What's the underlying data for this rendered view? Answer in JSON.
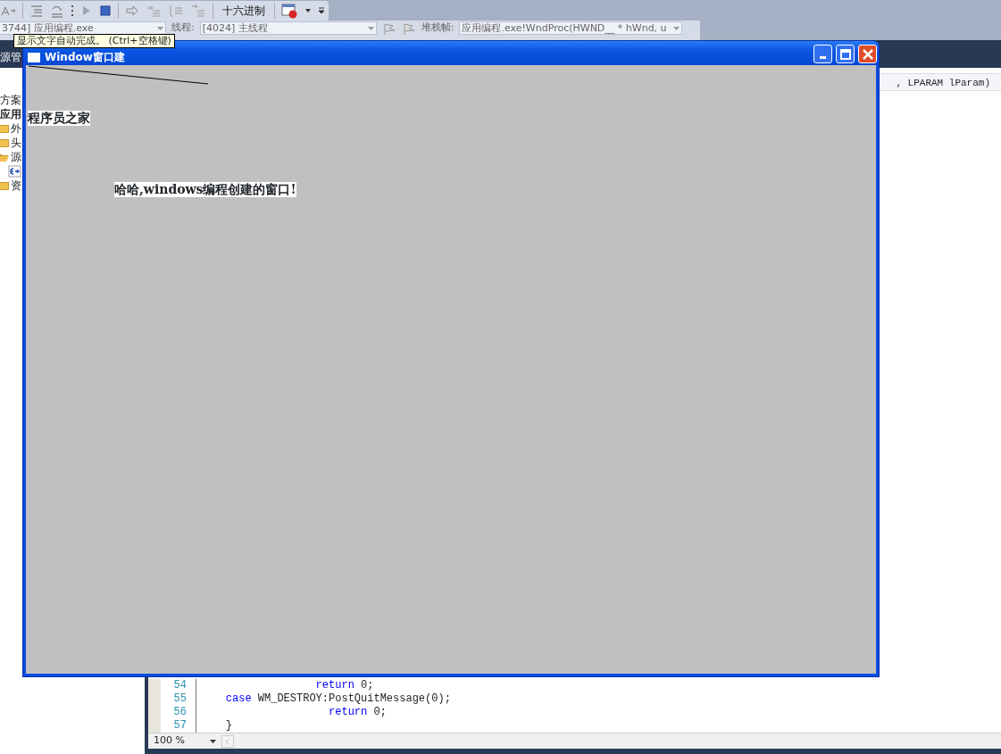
{
  "toolbar": {
    "hex_button": "十六进制"
  },
  "debug_bar": {
    "process": "3744] 应用编程.exe",
    "thread_label": "线程:",
    "thread": "[4024] 主线程",
    "stack_label": "堆栈帧:",
    "stack_frame": "应用编程.exe!WndProc(HWND__ * hWnd, u"
  },
  "tooltip": "显示文字自动完成。 (Ctrl+空格键)",
  "solution_explorer": {
    "title": "源管",
    "items": [
      {
        "label": "方案",
        "kind": "solution"
      },
      {
        "label": "应用",
        "kind": "project",
        "children": [
          {
            "label": "外",
            "kind": "folder",
            "expanded": false
          },
          {
            "label": "头",
            "kind": "folder",
            "expanded": false
          },
          {
            "label": "源",
            "kind": "folder",
            "expanded": true,
            "children": [
              {
                "kind": "file"
              }
            ]
          },
          {
            "label": "资",
            "kind": "folder",
            "expanded": false
          }
        ]
      }
    ]
  },
  "editor": {
    "signature": ", LPARAM lParam)",
    "lines": [
      {
        "number": "54",
        "tokens": [
          {
            "text": "                  return",
            "kind": "keyword"
          },
          {
            "text": " 0;",
            "kind": "plain"
          }
        ]
      },
      {
        "number": "55",
        "tokens": [
          {
            "text": "    case",
            "kind": "keyword"
          },
          {
            "text": " WM_DESTROY:PostQuitMessage(0);",
            "kind": "plain"
          }
        ]
      },
      {
        "number": "56",
        "tokens": [
          {
            "text": "                    return",
            "kind": "keyword"
          },
          {
            "text": " 0;",
            "kind": "plain"
          }
        ]
      },
      {
        "number": "57",
        "tokens": [
          {
            "text": "    }",
            "kind": "plain"
          }
        ]
      }
    ],
    "zoom": "100 %"
  },
  "app_window": {
    "title": "Window窗口建",
    "texts": [
      "程序员之家",
      "哈哈,windows编程创建的窗口!"
    ]
  }
}
